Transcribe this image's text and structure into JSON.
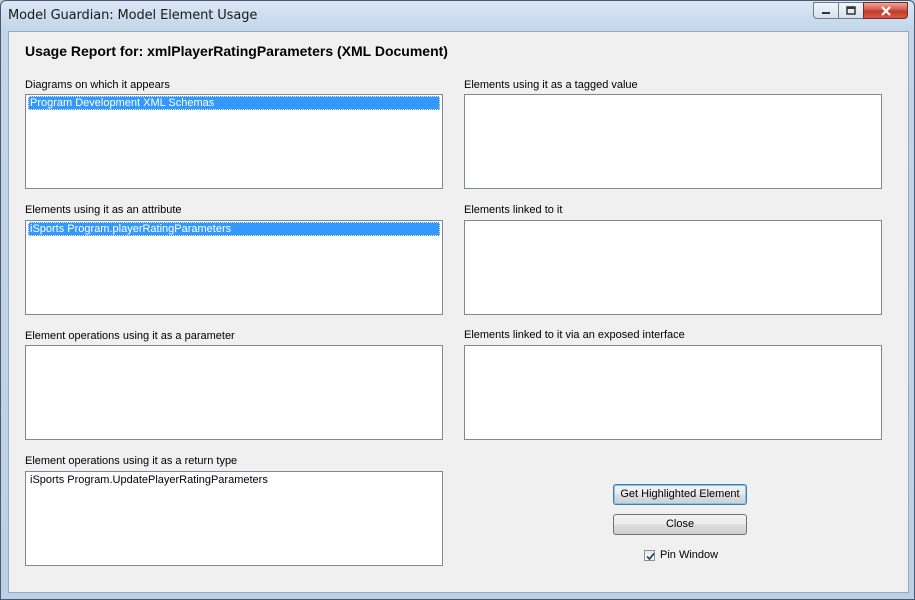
{
  "window": {
    "title": "Model Guardian: Model Element Usage"
  },
  "report_title": "Usage Report for: xmlPlayerRatingParameters (XML Document)",
  "panels": {
    "diagrams": {
      "label": "Diagrams on which it appears",
      "items": [
        "Program Development XML Schemas"
      ]
    },
    "tagged_value": {
      "label": "Elements using it as a tagged value",
      "items": []
    },
    "attribute": {
      "label": "Elements using it as an attribute",
      "items": [
        "iSports Program.playerRatingParameters"
      ]
    },
    "linked": {
      "label": "Elements linked to it",
      "items": []
    },
    "parameter": {
      "label": "Element operations using it as a parameter",
      "items": []
    },
    "exposed_interface": {
      "label": "Elements linked to it via an exposed interface",
      "items": []
    },
    "return_type": {
      "label": "Element operations using it as a return type",
      "items": [
        "iSports Program.UpdatePlayerRatingParameters"
      ]
    }
  },
  "buttons": {
    "get_highlighted": "Get Highlighted Element",
    "close": "Close"
  },
  "pin_window": {
    "label": "Pin Window",
    "checked": true
  }
}
